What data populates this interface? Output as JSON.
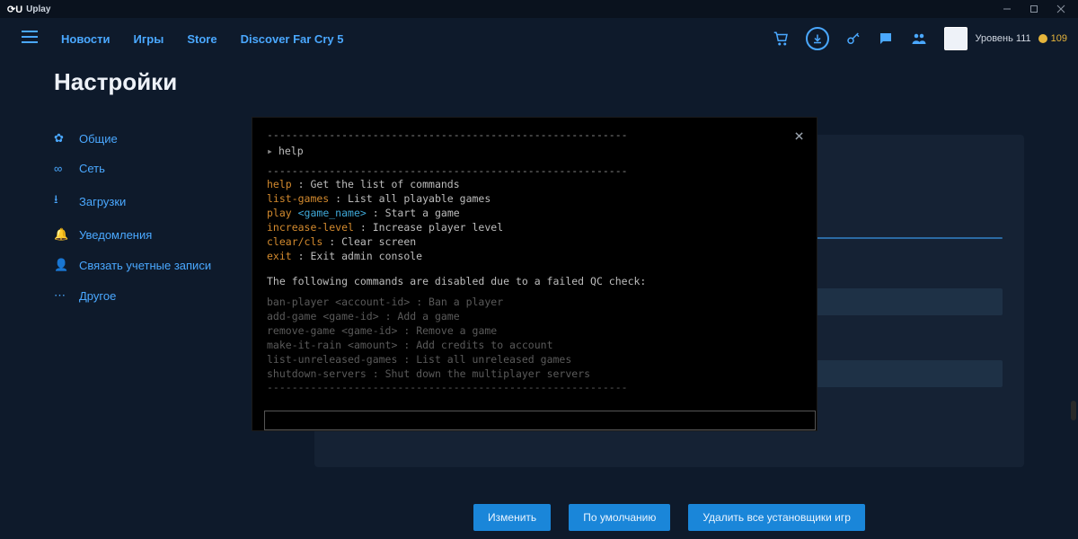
{
  "titlebar": {
    "brand": "Uplay"
  },
  "nav": {
    "items": [
      "Новости",
      "Игры",
      "Store",
      "Discover Far Cry 5"
    ],
    "user": {
      "name_hidden": true,
      "level_label": "Уровень 111",
      "coins": "109"
    }
  },
  "page": {
    "title": "Настройки",
    "sidebar": [
      {
        "icon": "gear-icon",
        "label": "Общие"
      },
      {
        "icon": "link-icon",
        "label": "Сеть"
      },
      {
        "icon": "download-icon",
        "label": "Загрузки"
      },
      {
        "icon": "bell-icon",
        "label": "Уведомления"
      },
      {
        "icon": "user-icon",
        "label": "Связать учетные записи"
      },
      {
        "icon": "more-icon",
        "label": "Другое"
      }
    ],
    "buttons": {
      "edit": "Изменить",
      "default": "По умолчанию",
      "delete_all": "Удалить все установщики игр"
    }
  },
  "console": {
    "separator": "----------------------------------------------------------",
    "prompt_cmd": "help",
    "enabled": [
      {
        "name": "help",
        "arg": "",
        "desc": "Get the list of commands"
      },
      {
        "name": "list-games",
        "arg": "",
        "desc": "List all playable games"
      },
      {
        "name": "play",
        "arg": "<game_name>",
        "desc": "Start a game"
      },
      {
        "name": "increase-level",
        "arg": "",
        "desc": "Increase player level"
      },
      {
        "name": "clear/cls",
        "arg": "",
        "desc": "Clear screen"
      },
      {
        "name": "exit",
        "arg": "",
        "desc": "Exit admin console"
      }
    ],
    "disabled_msg": "The following commands are disabled due to a failed QC check:",
    "disabled": [
      {
        "name": "ban-player",
        "arg": "<account-id>",
        "desc": "Ban a player"
      },
      {
        "name": "add-game",
        "arg": "<game-id>",
        "desc": "Add a game"
      },
      {
        "name": "remove-game",
        "arg": "<game-id>",
        "desc": "Remove a game"
      },
      {
        "name": "make-it-rain",
        "arg": "<amount>",
        "desc": "Add credits to account"
      },
      {
        "name": "list-unreleased-games",
        "arg": "",
        "desc": "List all unreleased games"
      },
      {
        "name": "shutdown-servers",
        "arg": "",
        "desc": "Shut down the multiplayer servers"
      }
    ]
  }
}
